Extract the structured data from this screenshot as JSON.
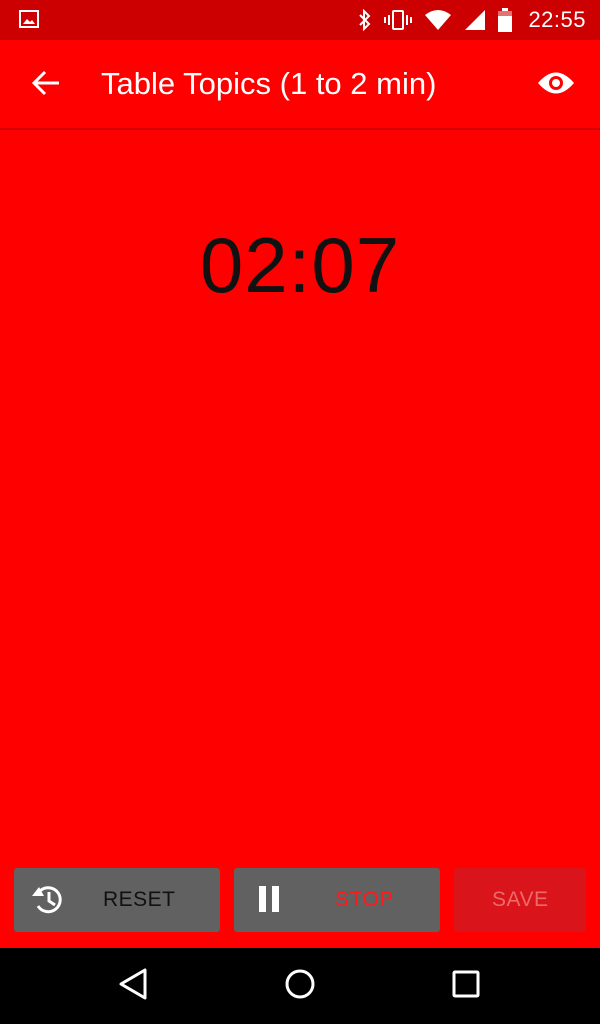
{
  "status_bar": {
    "time": "22:55",
    "icons": [
      "gallery-icon",
      "bluetooth-icon",
      "vibrate-icon",
      "wifi-icon",
      "signal-icon",
      "battery-icon"
    ]
  },
  "app_bar": {
    "title": "Table Topics (1 to 2 min)",
    "back_icon": "arrow-back-icon",
    "action_icon": "eye-icon"
  },
  "timer": {
    "display": "02:07"
  },
  "buttons": {
    "reset_label": "RESET",
    "stop_label": "STOP",
    "save_label": "SAVE"
  },
  "colors": {
    "background": "#ff0000",
    "status_bar": "#cc0000",
    "button_gray": "#616161",
    "save_disabled": "#d9141a",
    "stop_text": "#ff1a1a"
  },
  "nav_bar": {
    "icons": [
      "nav-back-icon",
      "nav-home-icon",
      "nav-recents-icon"
    ]
  }
}
